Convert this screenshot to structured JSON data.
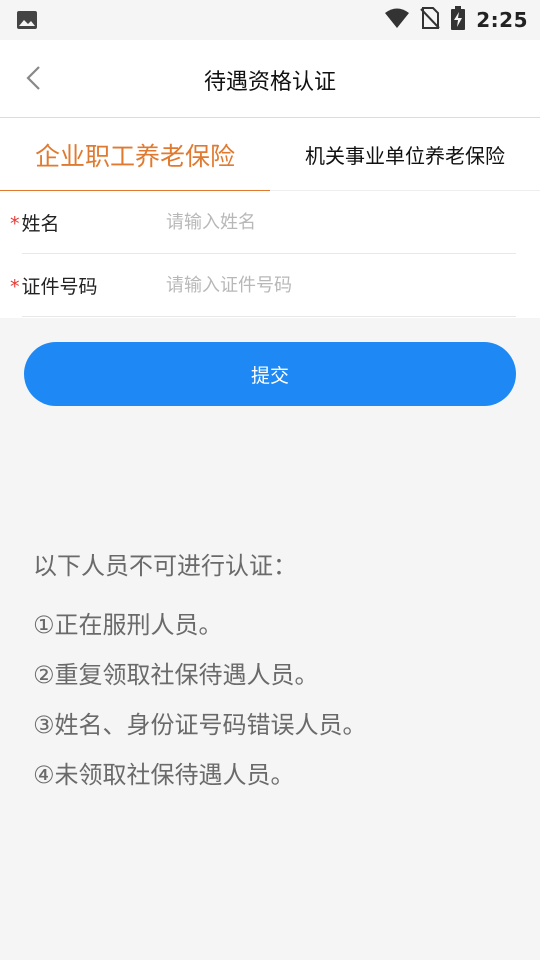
{
  "status_bar": {
    "time": "2:25",
    "left_icon": "image-icon",
    "right_icons": [
      "wifi-icon",
      "no-sim-icon",
      "battery-charging-icon"
    ]
  },
  "header": {
    "back_icon": "chevron-left-icon",
    "title": "待遇资格认证"
  },
  "tabs": [
    {
      "label": "企业职工养老保险",
      "active": true
    },
    {
      "label": "机关事业单位养老保险",
      "active": false
    }
  ],
  "form": {
    "name": {
      "label": "姓名",
      "required_mark": "*",
      "placeholder": "请输入姓名",
      "value": ""
    },
    "id_number": {
      "label": "证件号码",
      "required_mark": "*",
      "placeholder": "请输入证件号码",
      "value": ""
    }
  },
  "submit_label": "提交",
  "notice": {
    "title": "以下人员不可进行认证：",
    "items": [
      "①正在服刑人员。",
      "②重复领取社保待遇人员。",
      "③姓名、身份证号码错误人员。",
      "④未领取社保待遇人员。"
    ]
  },
  "colors": {
    "accent_orange": "#e07a30",
    "primary_blue": "#1e88f5",
    "required_red": "#e53935",
    "background": "#f5f5f5"
  }
}
